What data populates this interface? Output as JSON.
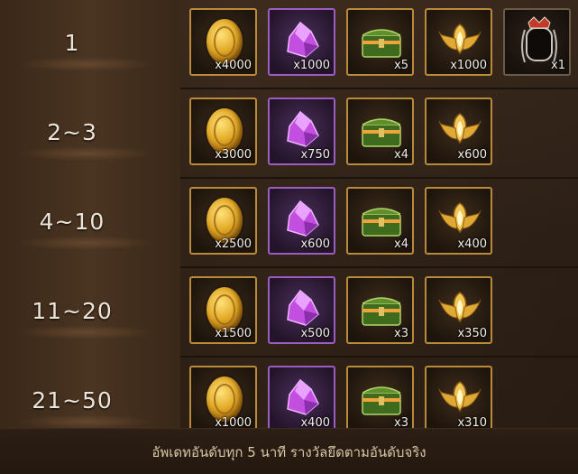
{
  "rows": [
    {
      "rank": "1",
      "rewards": [
        {
          "item": "gold-coin",
          "qty": "x4000"
        },
        {
          "item": "purple-crystal",
          "qty": "x1000"
        },
        {
          "item": "green-chest",
          "qty": "x5"
        },
        {
          "item": "golden-wings",
          "qty": "x1000"
        },
        {
          "item": "portrait-frame",
          "qty": "x1"
        }
      ]
    },
    {
      "rank": "2~3",
      "rewards": [
        {
          "item": "gold-coin",
          "qty": "x3000"
        },
        {
          "item": "purple-crystal",
          "qty": "x750"
        },
        {
          "item": "green-chest",
          "qty": "x4"
        },
        {
          "item": "golden-wings",
          "qty": "x600"
        }
      ]
    },
    {
      "rank": "4~10",
      "rewards": [
        {
          "item": "gold-coin",
          "qty": "x2500"
        },
        {
          "item": "purple-crystal",
          "qty": "x600"
        },
        {
          "item": "green-chest",
          "qty": "x4"
        },
        {
          "item": "golden-wings",
          "qty": "x400"
        }
      ]
    },
    {
      "rank": "11~20",
      "rewards": [
        {
          "item": "gold-coin",
          "qty": "x1500"
        },
        {
          "item": "purple-crystal",
          "qty": "x500"
        },
        {
          "item": "green-chest",
          "qty": "x3"
        },
        {
          "item": "golden-wings",
          "qty": "x350"
        }
      ]
    },
    {
      "rank": "21~50",
      "rewards": [
        {
          "item": "gold-coin",
          "qty": "x1000"
        },
        {
          "item": "purple-crystal",
          "qty": "x400"
        },
        {
          "item": "green-chest",
          "qty": "x3"
        },
        {
          "item": "golden-wings",
          "qty": "x310"
        }
      ]
    }
  ],
  "footer": {
    "text": "อัพเดทอันดับทุก 5 นาที รางวัลยึดตามอันดับจริง"
  },
  "colors": {
    "gold_border": "#b98a3a",
    "purple_border": "#9a5ec0",
    "text_light": "#ece4d6"
  }
}
